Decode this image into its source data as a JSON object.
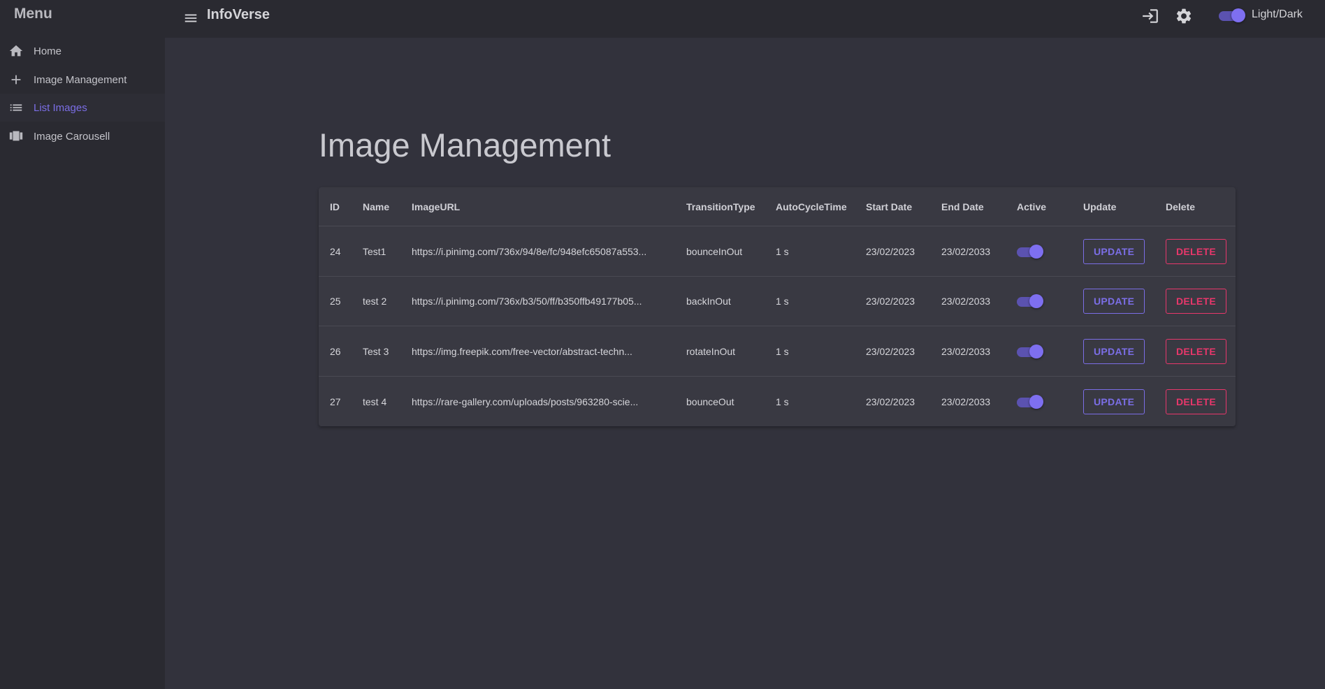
{
  "sidebar": {
    "title": "Menu",
    "items": [
      {
        "label": "Home",
        "icon": "home-icon",
        "active": false
      },
      {
        "label": "Image Management",
        "icon": "plus-icon",
        "active": false
      },
      {
        "label": "List Images",
        "icon": "list-icon",
        "active": true
      },
      {
        "label": "Image Carousell",
        "icon": "carousel-icon",
        "active": false
      }
    ]
  },
  "appbar": {
    "title": "InfoVerse",
    "theme_label": "Light/Dark",
    "theme_toggle_on": true
  },
  "main": {
    "title": "Image Management",
    "table": {
      "headers": [
        "ID",
        "Name",
        "ImageURL",
        "TransitionType",
        "AutoCycleTime",
        "Start Date",
        "End Date",
        "Active",
        "Update",
        "Delete"
      ],
      "rows": [
        {
          "id": "24",
          "name": "Test1",
          "url": "https://i.pinimg.com/736x/94/8e/fc/948efc65087a553...",
          "transition": "bounceInOut",
          "auto": "1 s",
          "start": "23/02/2023",
          "end": "23/02/2033",
          "active": true,
          "update": "UPDATE",
          "delete": "DELETE"
        },
        {
          "id": "25",
          "name": "test 2",
          "url": "https://i.pinimg.com/736x/b3/50/ff/b350ffb49177b05...",
          "transition": "backInOut",
          "auto": "1 s",
          "start": "23/02/2023",
          "end": "23/02/2033",
          "active": true,
          "update": "UPDATE",
          "delete": "DELETE"
        },
        {
          "id": "26",
          "name": "Test 3",
          "url": "https://img.freepik.com/free-vector/abstract-techn...",
          "transition": "rotateInOut",
          "auto": "1 s",
          "start": "23/02/2023",
          "end": "23/02/2033",
          "active": true,
          "update": "UPDATE",
          "delete": "DELETE"
        },
        {
          "id": "27",
          "name": "test 4",
          "url": "https://rare-gallery.com/uploads/posts/963280-scie...",
          "transition": "bounceOut",
          "auto": "1 s",
          "start": "23/02/2023",
          "end": "23/02/2033",
          "active": true,
          "update": "UPDATE",
          "delete": "DELETE"
        }
      ]
    }
  },
  "colors": {
    "accent": "#7b6ee6",
    "danger": "#e8376b",
    "background": "#32323c",
    "sidebar": "#2a2a31",
    "card": "#393942"
  }
}
